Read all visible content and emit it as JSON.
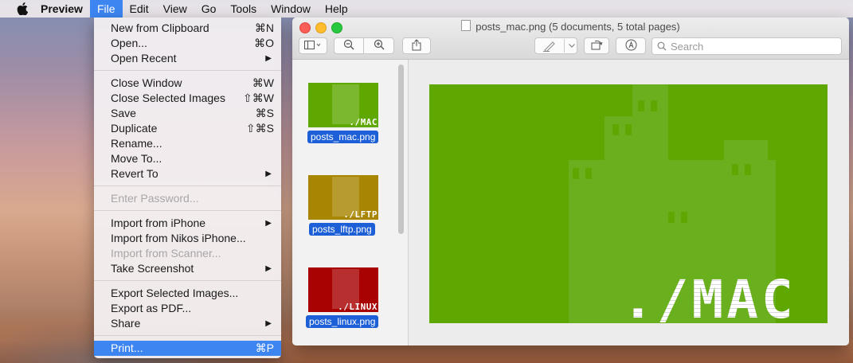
{
  "menubar": {
    "app_name": "Preview",
    "items": [
      "File",
      "Edit",
      "View",
      "Go",
      "Tools",
      "Window",
      "Help"
    ]
  },
  "file_menu": {
    "items": [
      {
        "label": "New from Clipboard",
        "shortcut": "⌘N"
      },
      {
        "label": "Open...",
        "shortcut": "⌘O"
      },
      {
        "label": "Open Recent",
        "submenu": "▶"
      },
      {
        "label": "Close Window",
        "shortcut": "⌘W"
      },
      {
        "label": "Close Selected Images",
        "shortcut": "⇧⌘W"
      },
      {
        "label": "Save",
        "shortcut": "⌘S"
      },
      {
        "label": "Duplicate",
        "shortcut": "⇧⌘S"
      },
      {
        "label": "Rename..."
      },
      {
        "label": "Move To..."
      },
      {
        "label": "Revert To",
        "submenu": "▶"
      },
      {
        "label": "Enter Password...",
        "disabled": true
      },
      {
        "label": "Import from iPhone",
        "submenu": "▶"
      },
      {
        "label": "Import from Nikos iPhone..."
      },
      {
        "label": "Import from Scanner...",
        "disabled": true
      },
      {
        "label": "Take Screenshot",
        "submenu": "▶"
      },
      {
        "label": "Export Selected Images..."
      },
      {
        "label": "Export as PDF..."
      },
      {
        "label": "Share",
        "submenu": "▶"
      },
      {
        "label": "Print...",
        "shortcut": "⌘P",
        "highlighted": true
      }
    ]
  },
  "window": {
    "title": "posts_mac.png (5 documents, 5 total pages)",
    "search_placeholder": "Search",
    "toolbar_icons": [
      "sidebar-toggle-icon",
      "zoom-out-icon",
      "zoom-in-icon",
      "share-icon",
      "markup-pen-icon",
      "rotate-icon",
      "annotate-icon",
      "search-icon"
    ]
  },
  "sidebar": {
    "thumbnails": [
      {
        "label": "posts_mac.png",
        "thumb_text": "./MAC",
        "color": "#5fa802"
      },
      {
        "label": "posts_lftp.png",
        "thumb_text": "./LFTP",
        "color": "#a88502"
      },
      {
        "label": "posts_linux.png",
        "thumb_text": "./LINUX",
        "color": "#a80202"
      }
    ]
  },
  "document": {
    "text": "./MAC",
    "background": "#5fa802"
  },
  "colors": {
    "accent": "#3d86f2",
    "selection": "#1d5fd6",
    "close": "#fc5f57",
    "minimize": "#fdbc2e",
    "zoom": "#28c840"
  }
}
